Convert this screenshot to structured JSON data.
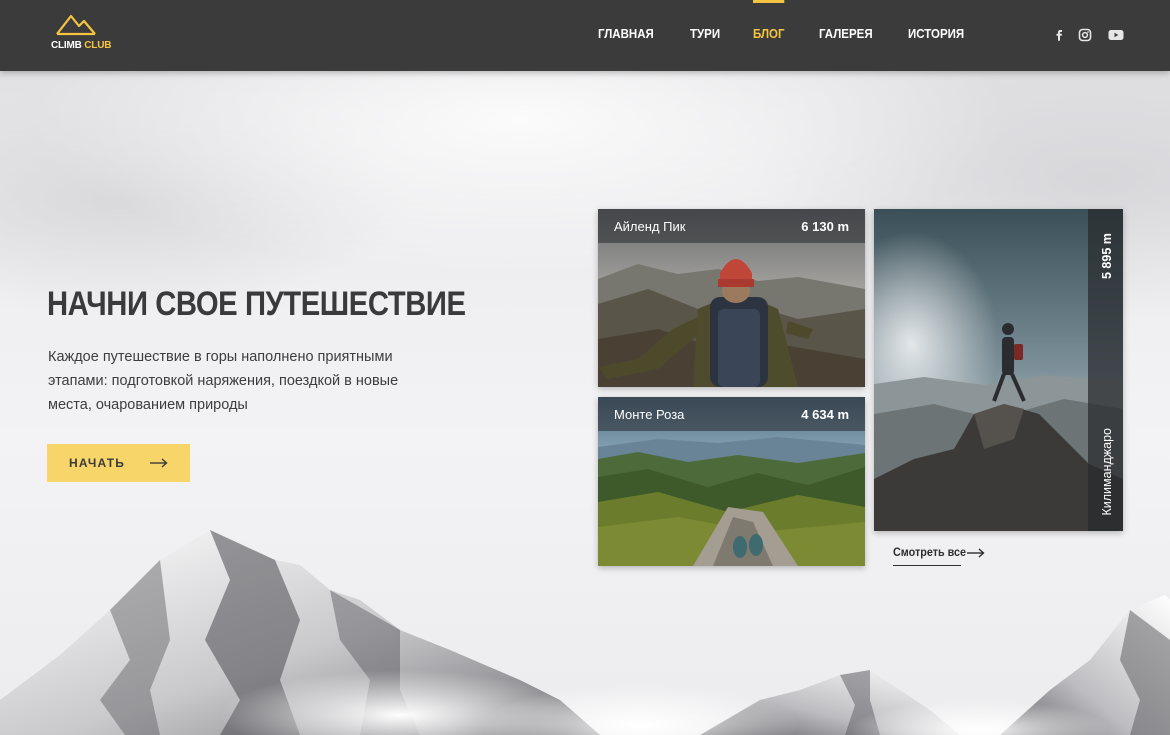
{
  "header": {
    "logo": {
      "text_main": "CLIMB",
      "text_accent": "CLUB",
      "icon": "mountain-icon"
    },
    "nav": [
      {
        "label": "ГЛАВНАЯ",
        "active": false
      },
      {
        "label": "ТУРИ",
        "active": false
      },
      {
        "label": "БЛОГ",
        "active": true
      },
      {
        "label": "ГАЛЕРЕЯ",
        "active": false
      },
      {
        "label": "ИСТОРИЯ",
        "active": false
      }
    ],
    "social": [
      "facebook-icon",
      "instagram-icon",
      "youtube-icon"
    ]
  },
  "hero": {
    "title": "НАЧНИ СВОЕ ПУТЕШЕСТВИЕ",
    "description": "Каждое путешествие в горы наполнено приятными этапами: подготовкой наряжения, поездкой в новые места, очарованием природы",
    "button_label": "НАЧАТЬ"
  },
  "cards": [
    {
      "name": "Айленд Пик",
      "altitude": "6 130 m"
    },
    {
      "name": "Монте Роза",
      "altitude": "4 634 m"
    },
    {
      "name": "Килиманджаро",
      "altitude": "5 895 m"
    }
  ],
  "see_all": "Смотреть все",
  "colors": {
    "accent": "#f5c542",
    "button": "#f8d568",
    "header_bg": "#3b3b3c",
    "text_dark": "#3a3a3c"
  }
}
